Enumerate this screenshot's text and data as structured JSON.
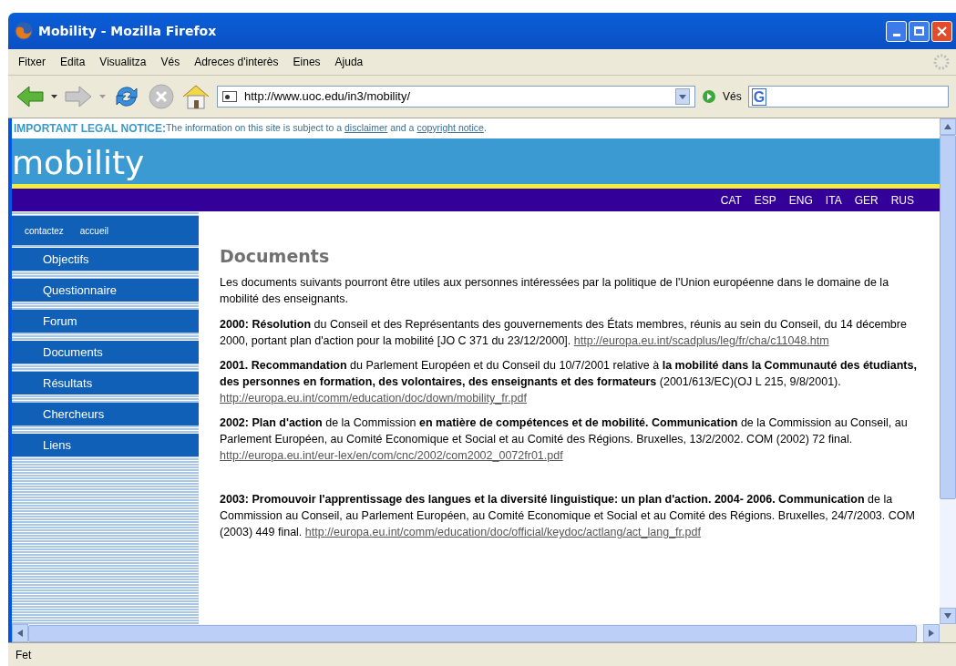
{
  "window": {
    "title": "Mobility - Mozilla Firefox"
  },
  "menu": [
    "Fitxer",
    "Edita",
    "Visualitza",
    "Vés",
    "Adreces d'interès",
    "Eines",
    "Ajuda"
  ],
  "toolbar": {
    "address": "http://www.uoc.edu/in3/mobility/",
    "go": "Vés",
    "search_logo": "G"
  },
  "notice": {
    "label": "IMPORTANT LEGAL NOTICE:",
    "text": "The information on this site is subject to a",
    "link1": "disclaimer",
    "middle": "and a",
    "link2": "copyright notice",
    "end": "."
  },
  "site_title": "mobility",
  "languages": [
    "CAT",
    "ESP",
    "ENG",
    "ITA",
    "GER",
    "RUS"
  ],
  "sidebar": {
    "top_links": [
      "contactez",
      "accueil"
    ],
    "items": [
      {
        "label": "Objectifs",
        "selected": false
      },
      {
        "label": "Questionnaire",
        "selected": false
      },
      {
        "label": "Forum",
        "selected": false
      },
      {
        "label": "Documents",
        "selected": false
      },
      {
        "label": "Résultats",
        "selected": false
      },
      {
        "label": "Chercheurs",
        "selected": false
      },
      {
        "label": "Liens",
        "selected": false
      }
    ]
  },
  "heading": "Documents",
  "intro": "Les documents suivants pourront être utiles aux personnes intéressées par la politique de l'Union européenne dans le domaine de la mobilité des enseignants.",
  "documents": [
    {
      "text": "**2000: Résolution** du Conseil et des Représentants des gouvernements des États membres, réunis au sein du Conseil, du 14 décembre 2000, portant plan d'action pour la mobilité [JO C 371 du 23/12/2000].",
      "link": "http://europa.eu.int/scadplus/leg/fr/cha/c11048.htm"
    },
    {
      "text": "**2001. Recommandation** du Parlement Européen et du Conseil du 10/7/2001 relative à **la mobilité dans la Communauté des étudiants, des personnes en formation, des volontaires, des enseignants et des formateurs** (2001/613/EC)(OJ L 215, 9/8/2001).",
      "link": "http://europa.eu.int/comm/education/doc/down/mobility_fr.pdf"
    },
    {
      "text": "**2002: Plan d'action** de la Commission **en matière de compétences et de mobilité. Communication** de la Commission au Conseil, au Parlement Européen, au Comité Economique et Social et au Comité des Régions. Bruxelles, 13/2/2002. COM (2002) 72 final.",
      "link": "http://europa.eu.int/eur-lex/en/com/cnc/2002/com2002_0072fr01.pdf"
    },
    {
      "text": "**2003: Promouvoir l'apprentissage des langues et la diversité linguistique: un plan d'action. 2004- 2006. Communication** de la Commission au Conseil, au Parlement Européen, au Comité Economique et Social et au Comité des Régions. Bruxelles, 24/7/2003. COM (2003) 449 final.",
      "link": "http://europa.eu.int/comm/education/doc/official/keydoc/actlang/act_lang_fr.pdf"
    }
  ],
  "status_bar": "Fet"
}
